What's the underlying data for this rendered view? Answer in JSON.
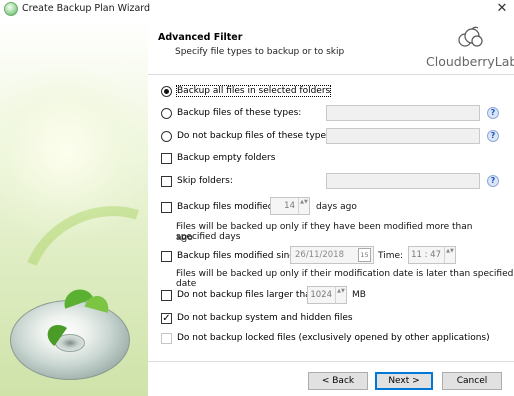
{
  "window": {
    "title": "Create Backup Plan Wizard",
    "close_glyph": "✕",
    "app_icon": "cloudberry-icon"
  },
  "header": {
    "title": "Advanced Filter",
    "subtitle": "Specify file types to backup or to skip",
    "logo_text": "CloudberryLab",
    "logo_icon": "cloudberry-icon"
  },
  "options": {
    "backup_all": "Backup all files in selected folders",
    "backup_types": "Backup files of these types:",
    "not_backup_types": "Do not backup files of these types:",
    "backup_empty": "Backup empty folders",
    "skip_folders": "Skip folders:",
    "modified": "Backup files modified:",
    "modified_days_value": "14",
    "modified_days_unit": "days ago",
    "modified_note_line1": "Files will be backed up only if they have been modified more than specified days",
    "modified_note_line2": "ago",
    "modified_since": "Backup files modified since:",
    "since_date": "26/11/2018",
    "calendar_day": "15",
    "time_label": "Time:",
    "time_value": "11 : 47",
    "since_note": "Files will be backed up only if their modification date is later than specified date",
    "larger_than": "Do not backup files larger than:",
    "larger_value": "1024",
    "larger_unit": "MB",
    "system_hidden": "Do not backup system and hidden files",
    "locked": "Do not backup locked files (exclusively opened by other applications)",
    "checkmark": "✓",
    "help_glyph": "?",
    "spin_glyph": "▲▼"
  },
  "buttons": {
    "back": "< Back",
    "next": "Next >",
    "cancel": "Cancel"
  },
  "colors": {
    "accent": "#0078d7",
    "help_blue": "#1a56c9",
    "panel_green": "#cfe3a9"
  }
}
